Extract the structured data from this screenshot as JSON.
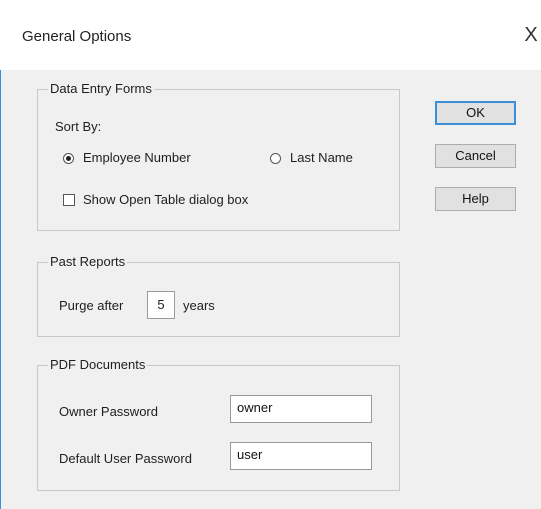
{
  "window": {
    "title": "General Options",
    "close_glyph": "X"
  },
  "buttons": {
    "ok": "OK",
    "cancel": "Cancel",
    "help": "Help"
  },
  "data_entry_forms": {
    "legend": "Data Entry Forms",
    "sort_by_label": "Sort By:",
    "option_employee_number": "Employee Number",
    "option_last_name": "Last Name",
    "selected_sort": "Employee Number",
    "show_open_table_label": "Show Open Table dialog box",
    "show_open_table_checked": false
  },
  "past_reports": {
    "legend": "Past Reports",
    "purge_prefix": "Purge after",
    "purge_value": "5",
    "purge_suffix": "years"
  },
  "pdf_documents": {
    "legend": "PDF Documents",
    "owner_password_label": "Owner Password",
    "owner_password_value": "owner",
    "default_user_password_label": "Default User Password",
    "default_user_password_value": "user"
  }
}
